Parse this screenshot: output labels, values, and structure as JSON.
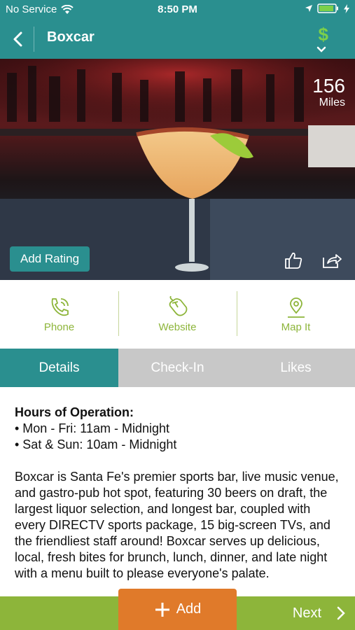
{
  "status_bar": {
    "carrier": "No Service",
    "time": "8:50 PM"
  },
  "nav": {
    "title": "Boxcar",
    "dollar": "$"
  },
  "hero": {
    "distance": "156",
    "distance_unit": "Miles",
    "add_rating": "Add Rating"
  },
  "actions": [
    {
      "label": "Phone"
    },
    {
      "label": "Website"
    },
    {
      "label": "Map It"
    }
  ],
  "tabs": [
    {
      "label": "Details",
      "active": true
    },
    {
      "label": "Check-In"
    },
    {
      "label": "Likes"
    }
  ],
  "details": {
    "hours_heading": "Hours of Operation:",
    "hours": [
      "• Mon - Fri: 11am - Midnight",
      "• Sat & Sun: 10am - Midnight"
    ],
    "description": "Boxcar is Santa Fe's premier sports bar, live music venue, and gastro-pub hot spot, featuring 30 beers on draft, the largest liquor selection, and longest bar, coupled with every DIRECTV sports package, 15 big-screen TVs, and the friendliest staff around! Boxcar serves up delicious, local, fresh bites for brunch, lunch, dinner, and late night with a menu built to please everyone's palate."
  },
  "bottom": {
    "add": "Add",
    "next": "Next"
  },
  "colors": {
    "teal": "#2a8f8f",
    "green": "#8db53a",
    "orange": "#e07a2a"
  }
}
